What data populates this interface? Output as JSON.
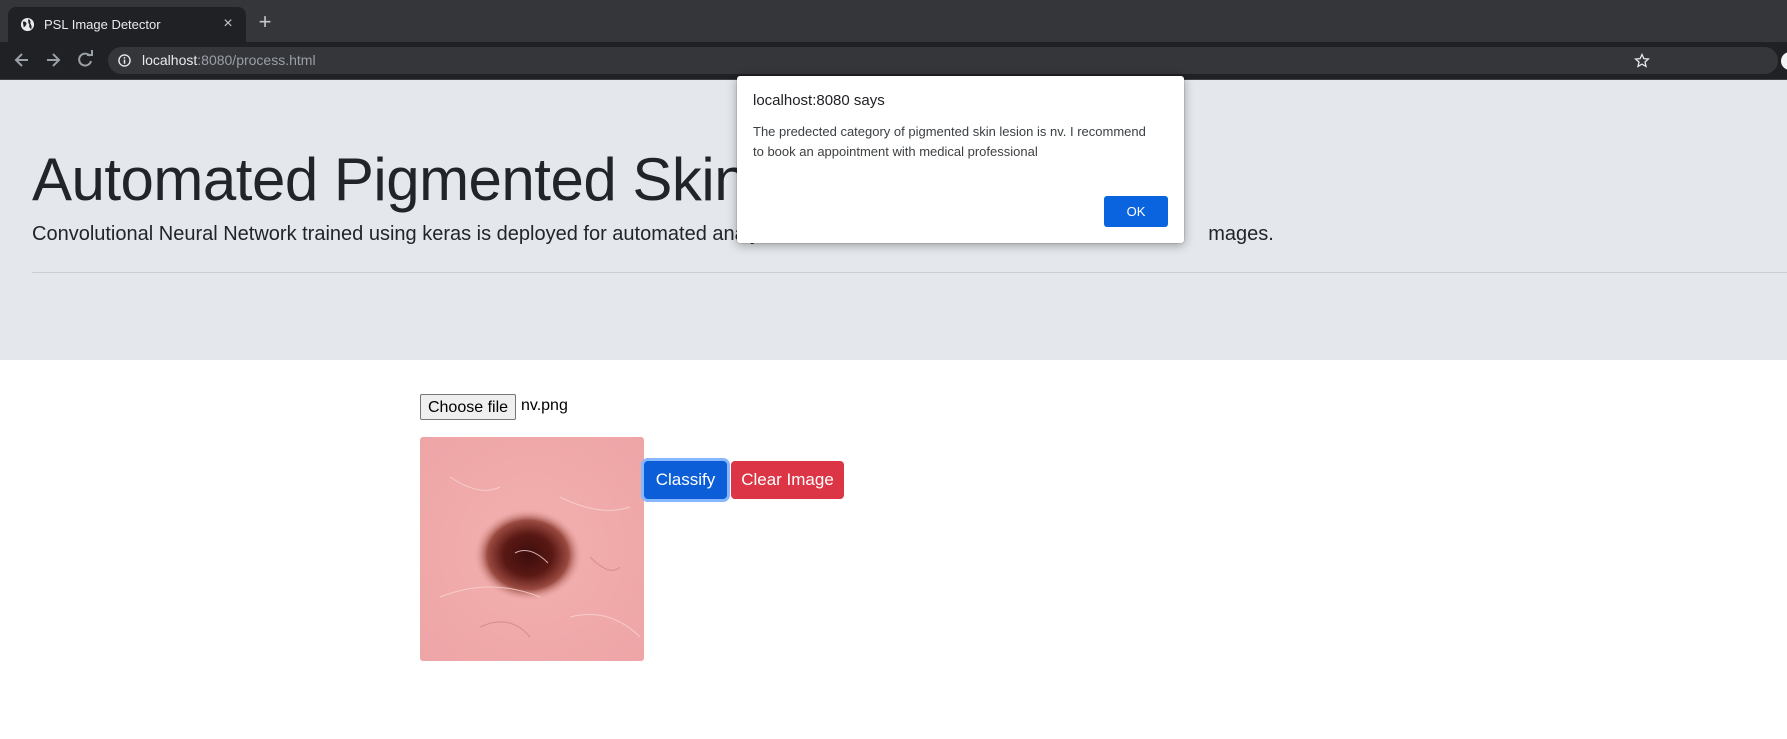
{
  "browser": {
    "tab_title": "PSL Image Detector",
    "tab_close": "×",
    "new_tab": "+",
    "url_host": "localhost",
    "url_rest": ":8080/process.html"
  },
  "page": {
    "heading": "Automated Pigmented Skin Le",
    "lead": "Convolutional Neural Network trained using keras is deployed for automated analy",
    "lead_tail": "mages."
  },
  "upload": {
    "choose_label": "Choose file",
    "file_name": "nv.png"
  },
  "buttons": {
    "classify": "Classify",
    "clear": "Clear Image"
  },
  "dialog": {
    "title": "localhost:8080 says",
    "message": "The predected category of pigmented skin lesion is nv. I recommend to book an appointment with medical professional",
    "ok": "OK"
  },
  "colors": {
    "primary": "#0b5ed7",
    "danger": "#dc3545",
    "jumbotron_bg": "#e4e7eb"
  },
  "icons": {
    "favicon": "globe-icon",
    "back": "arrow-left-icon",
    "forward": "arrow-right-icon",
    "reload": "reload-icon",
    "site_info": "info-icon",
    "bookmark": "star-icon"
  }
}
